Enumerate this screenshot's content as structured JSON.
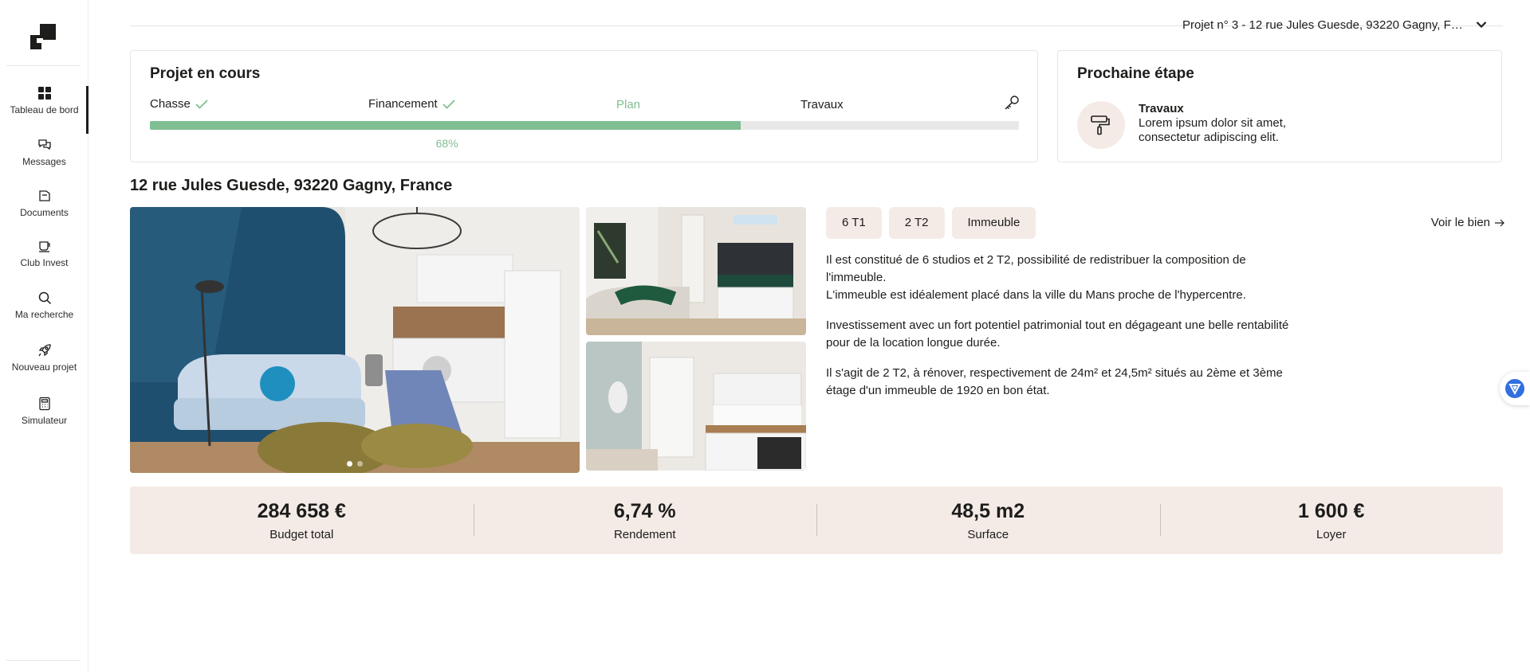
{
  "sidebar": {
    "items": [
      {
        "label": "Tableau de bord",
        "icon": "dashboard-icon",
        "active": true
      },
      {
        "label": "Messages",
        "icon": "chat-icon"
      },
      {
        "label": "Documents",
        "icon": "folder-icon"
      },
      {
        "label": "Club Invest",
        "icon": "coffee-icon"
      },
      {
        "label": "Ma recherche",
        "icon": "search-icon"
      },
      {
        "label": "Nouveau projet",
        "icon": "rocket-icon"
      },
      {
        "label": "Simulateur",
        "icon": "calculator-icon"
      }
    ]
  },
  "header": {
    "project_select": "Projet n° 3 - 12 rue Jules Guesde, 93220 Gagny, France"
  },
  "progress": {
    "title": "Projet en cours",
    "steps": [
      {
        "label": "Chasse",
        "state": "done"
      },
      {
        "label": "Financement",
        "state": "done"
      },
      {
        "label": "Plan",
        "state": "current"
      },
      {
        "label": "Travaux",
        "state": "todo"
      }
    ],
    "percent": 0.68,
    "percent_label": "68%",
    "end_icon": "key-icon"
  },
  "next_step": {
    "title": "Prochaine étape",
    "name": "Travaux",
    "description": "Lorem ipsum dolor sit amet, consectetur adipiscing elit.",
    "icon": "paint-roller-icon"
  },
  "property": {
    "address": "12 rue Jules Guesde, 93220 Gagny, France",
    "tags": [
      "6 T1",
      "2 T2",
      "Immeuble"
    ],
    "view_link": "Voir le bien",
    "description": [
      "Il est constitué de 6 studios et 2 T2, possibilité de redistribuer la composition de l'immeuble.\nL'immeuble est idéalement placé dans la ville du Mans proche de l'hypercentre.",
      "Investissement avec un fort potentiel patrimonial tout en dégageant une belle rentabilité pour de la location longue durée.",
      "Il s'agit de 2 T2, à rénover, respectivement de 24m² et 24,5m² situés au 2ème et 3ème étage d'un immeuble de 1920 en bon état."
    ],
    "carousel": {
      "count": 2,
      "active": 1
    }
  },
  "stats": [
    {
      "value": "284 658 €",
      "label": "Budget total"
    },
    {
      "value": "6,74 %",
      "label": "Rendement"
    },
    {
      "value": "48,5 m2",
      "label": "Surface"
    },
    {
      "value": "1 600 €",
      "label": "Loyer"
    }
  ],
  "colors": {
    "accent_green": "#7fbf93",
    "beige": "#f4ebe7",
    "text": "#1d1d1b"
  }
}
